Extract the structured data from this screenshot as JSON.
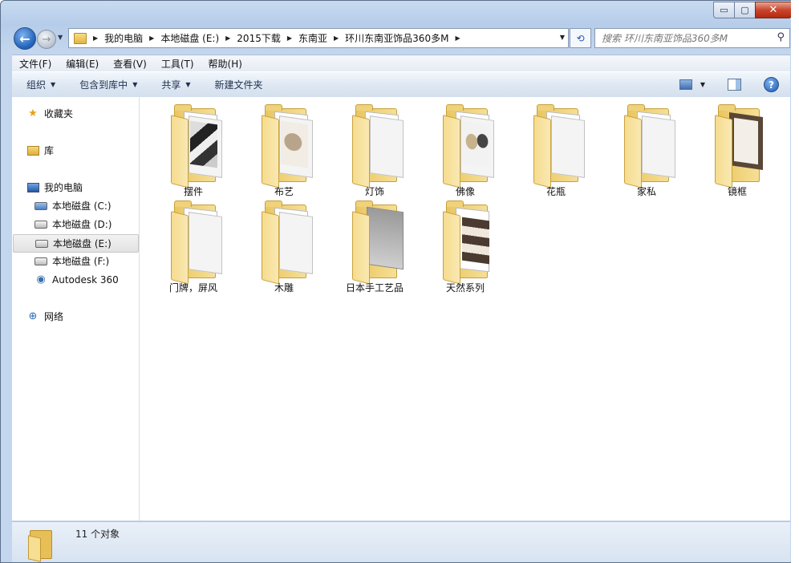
{
  "window": {
    "controls": {
      "minimize": "▭",
      "maximize": "▢",
      "close": "✕"
    }
  },
  "nav": {
    "back_icon": "←",
    "forward_icon": "→",
    "breadcrumbs": [
      "我的电脑",
      "本地磁盘 (E:)",
      "2015下载",
      "东南亚",
      "环川东南亚饰品360多M"
    ],
    "refresh_icon": "⟲",
    "search_placeholder": "搜索 环川东南亚饰品360多M",
    "search_icon": "⚲"
  },
  "menu": [
    "文件(F)",
    "编辑(E)",
    "查看(V)",
    "工具(T)",
    "帮助(H)"
  ],
  "toolbar": {
    "organize": "组织",
    "include_library": "包含到库中",
    "share": "共享",
    "new_folder": "新建文件夹",
    "help_icon": "?"
  },
  "sidebar": {
    "favorites": "收藏夹",
    "libraries": "库",
    "computer": "我的电脑",
    "drives": [
      "本地磁盘 (C:)",
      "本地磁盘 (D:)",
      "本地磁盘 (E:)",
      "本地磁盘 (F:)",
      "Autodesk 360"
    ],
    "selected_drive": "本地磁盘 (E:)",
    "network": "网络"
  },
  "folders": [
    "摆件",
    "布艺",
    "灯饰",
    "佛像",
    "花瓶",
    "家私",
    "镜框",
    "门牌，屏风",
    "木雕",
    "日本手工艺品",
    "天然系列"
  ],
  "status": {
    "count_text": "11 个对象"
  }
}
